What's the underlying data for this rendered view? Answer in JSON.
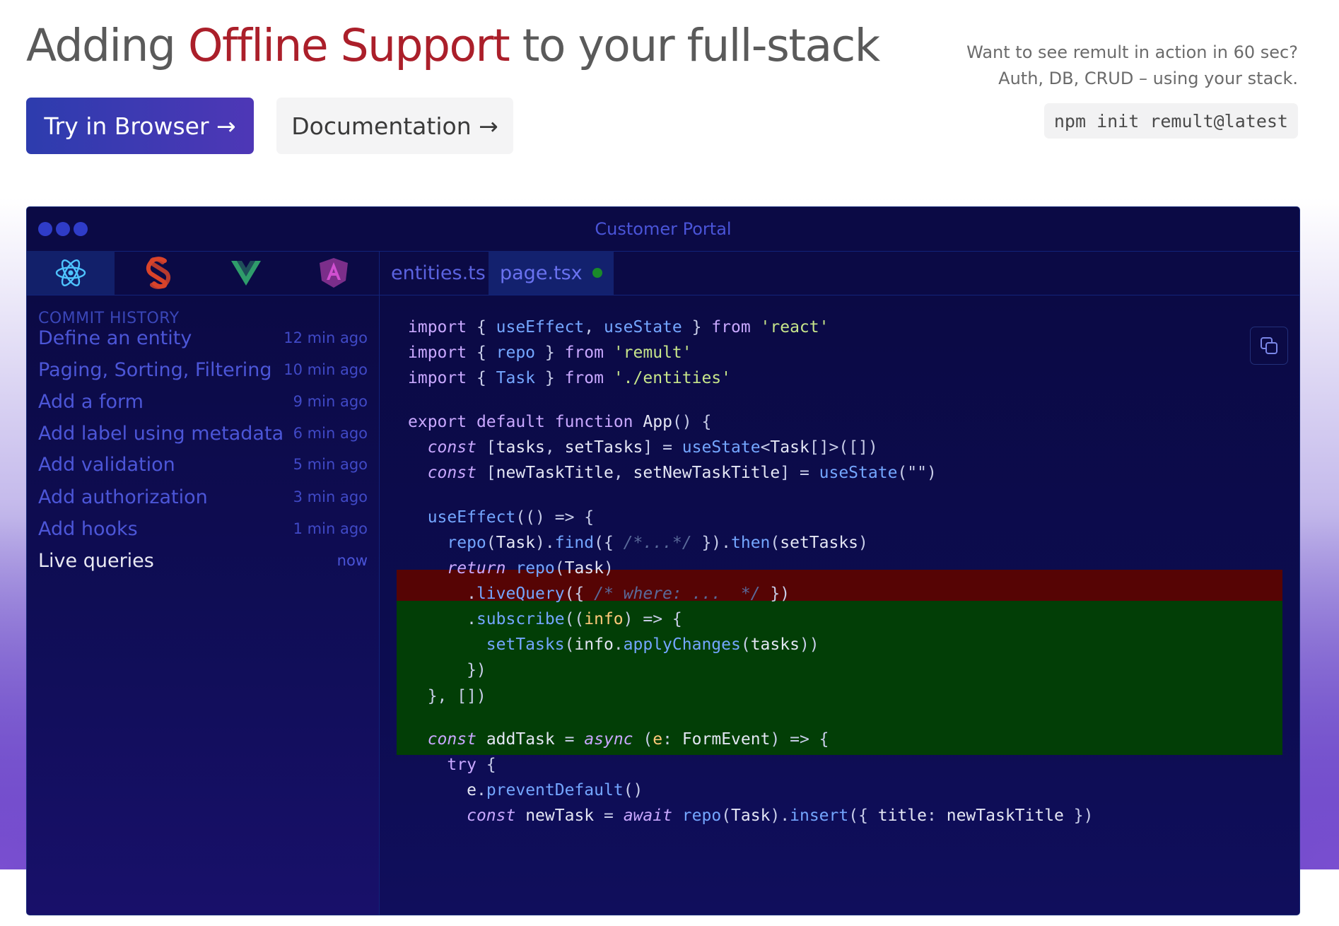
{
  "header": {
    "title_prefix": "Adding",
    "title_highlight": "Offline Support",
    "title_suffix": "to your full-stack",
    "try_button": "Try in Browser →",
    "docs_button": "Documentation →",
    "promo_line1": "Want to see remult in action in 60 sec?",
    "promo_line2": "Auth, DB, CRUD – using your stack.",
    "npm_command": "npm init remult@latest"
  },
  "window": {
    "title": "Customer Portal",
    "frameworks": [
      {
        "icon": "react-icon",
        "active": true
      },
      {
        "icon": "svelte-icon",
        "active": false
      },
      {
        "icon": "vue-icon",
        "active": false
      },
      {
        "icon": "angular-icon",
        "active": false
      }
    ],
    "file_tabs": [
      {
        "label": "entities.ts",
        "active": false
      },
      {
        "label": "page.tsx",
        "active": true,
        "modified": true
      }
    ]
  },
  "sidebar": {
    "heading": "COMMIT HISTORY",
    "commits": [
      {
        "label": "Define an entity",
        "time": "12 min ago"
      },
      {
        "label": "Paging, Sorting, Filtering",
        "time": "10 min ago"
      },
      {
        "label": "Add a form",
        "time": "9 min ago"
      },
      {
        "label": "Add label using metadata",
        "time": "6 min ago"
      },
      {
        "label": "Add validation",
        "time": "5 min ago"
      },
      {
        "label": "Add authorization",
        "time": "3 min ago"
      },
      {
        "label": "Add hooks",
        "time": "1 min ago"
      },
      {
        "label": "Live queries",
        "time": "now",
        "current": true
      }
    ]
  },
  "code": {
    "lines": [
      [
        [
          "kw",
          "import"
        ],
        [
          "pn",
          " { "
        ],
        [
          "fn",
          "useEffect"
        ],
        [
          "pn",
          ", "
        ],
        [
          "fn",
          "useState"
        ],
        [
          "pn",
          " } "
        ],
        [
          "kw",
          "from"
        ],
        [
          "pn",
          " "
        ],
        [
          "str",
          "'react'"
        ]
      ],
      [
        [
          "kw",
          "import"
        ],
        [
          "pn",
          " { "
        ],
        [
          "fn",
          "repo"
        ],
        [
          "pn",
          " } "
        ],
        [
          "kw",
          "from"
        ],
        [
          "pn",
          " "
        ],
        [
          "str",
          "'remult'"
        ]
      ],
      [
        [
          "kw",
          "import"
        ],
        [
          "pn",
          " { "
        ],
        [
          "fn",
          "Task"
        ],
        [
          "pn",
          " } "
        ],
        [
          "kw",
          "from"
        ],
        [
          "pn",
          " "
        ],
        [
          "str",
          "'./entities'"
        ]
      ],
      [
        [
          "kw",
          "export"
        ],
        [
          "pn",
          " "
        ],
        [
          "kw",
          "default"
        ],
        [
          "pn",
          " "
        ],
        [
          "kw",
          "function"
        ],
        [
          "pn",
          " "
        ],
        [
          "var",
          "App"
        ],
        [
          "pn",
          "() {"
        ]
      ],
      [
        [
          "pn",
          "  "
        ],
        [
          "ctl",
          "const"
        ],
        [
          "pn",
          " ["
        ],
        [
          "var",
          "tasks"
        ],
        [
          "pn",
          ", "
        ],
        [
          "var",
          "setTasks"
        ],
        [
          "pn",
          "] = "
        ],
        [
          "fn",
          "useState"
        ],
        [
          "pn",
          "<"
        ],
        [
          "var",
          "Task"
        ],
        [
          "pn",
          "[]>([])"
        ]
      ],
      [
        [
          "pn",
          "  "
        ],
        [
          "ctl",
          "const"
        ],
        [
          "pn",
          " ["
        ],
        [
          "var",
          "newTaskTitle"
        ],
        [
          "pn",
          ", "
        ],
        [
          "var",
          "setNewTaskTitle"
        ],
        [
          "pn",
          "] = "
        ],
        [
          "fn",
          "useState"
        ],
        [
          "pn",
          "(\"\")"
        ]
      ],
      [
        [
          "pn",
          "  "
        ],
        [
          "fn",
          "useEffect"
        ],
        [
          "pn",
          "(() => {"
        ]
      ],
      [
        [
          "pn",
          "    "
        ],
        [
          "fn",
          "repo"
        ],
        [
          "pn",
          "("
        ],
        [
          "var",
          "Task"
        ],
        [
          "pn",
          ")."
        ],
        [
          "fn",
          "find"
        ],
        [
          "pn",
          "({ "
        ],
        [
          "cmt",
          "/*...*/"
        ],
        [
          "pn",
          " })."
        ],
        [
          "fn",
          "then"
        ],
        [
          "pn",
          "("
        ],
        [
          "var",
          "setTasks"
        ],
        [
          "pn",
          ")"
        ]
      ],
      [
        [
          "pn",
          "    "
        ],
        [
          "ctl",
          "return"
        ],
        [
          "pn",
          " "
        ],
        [
          "fn",
          "repo"
        ],
        [
          "pn",
          "("
        ],
        [
          "var",
          "Task"
        ],
        [
          "pn",
          ")"
        ]
      ],
      [
        [
          "pn",
          "      ."
        ],
        [
          "fn",
          "liveQuery"
        ],
        [
          "pn",
          "({ "
        ],
        [
          "cmt",
          "/* where: ...  */"
        ],
        [
          "pn",
          " })"
        ]
      ],
      [
        [
          "pn",
          "      ."
        ],
        [
          "fn",
          "subscribe"
        ],
        [
          "pn",
          "(("
        ],
        [
          "par",
          "info"
        ],
        [
          "pn",
          ") => {"
        ]
      ],
      [
        [
          "pn",
          "        "
        ],
        [
          "fn",
          "setTasks"
        ],
        [
          "pn",
          "("
        ],
        [
          "var",
          "info"
        ],
        [
          "pn",
          "."
        ],
        [
          "fn",
          "applyChanges"
        ],
        [
          "pn",
          "("
        ],
        [
          "var",
          "tasks"
        ],
        [
          "pn",
          "))"
        ]
      ],
      [
        [
          "pn",
          "      })"
        ]
      ],
      [
        [
          "pn",
          "  }, [])"
        ]
      ],
      [
        [
          "pn",
          "  "
        ],
        [
          "ctl",
          "const"
        ],
        [
          "pn",
          " "
        ],
        [
          "var",
          "addTask"
        ],
        [
          "pn",
          " = "
        ],
        [
          "ctl",
          "async"
        ],
        [
          "pn",
          " ("
        ],
        [
          "par",
          "e"
        ],
        [
          "pn",
          ": "
        ],
        [
          "var",
          "FormEvent"
        ],
        [
          "pn",
          ") => {"
        ]
      ],
      [
        [
          "pn",
          "    "
        ],
        [
          "kw",
          "try"
        ],
        [
          "pn",
          " {"
        ]
      ],
      [
        [
          "pn",
          "      "
        ],
        [
          "var",
          "e"
        ],
        [
          "pn",
          "."
        ],
        [
          "fn",
          "preventDefault"
        ],
        [
          "pn",
          "()"
        ]
      ],
      [
        [
          "pn",
          "      "
        ],
        [
          "ctl",
          "const"
        ],
        [
          "pn",
          " "
        ],
        [
          "var",
          "newTask"
        ],
        [
          "pn",
          " = "
        ],
        [
          "ctl",
          "await"
        ],
        [
          "pn",
          " "
        ],
        [
          "fn",
          "repo"
        ],
        [
          "pn",
          "("
        ],
        [
          "var",
          "Task"
        ],
        [
          "pn",
          ")."
        ],
        [
          "fn",
          "insert"
        ],
        [
          "pn",
          "({ "
        ],
        [
          "var",
          "title"
        ],
        [
          "pn",
          ": "
        ],
        [
          "var",
          "newTaskTitle"
        ],
        [
          "pn",
          " })"
        ]
      ]
    ]
  },
  "colors": {
    "accent": "#ab1f2a",
    "window_bg": "#0b0a45",
    "deleted_line": "#560404",
    "added_line": "#023e06"
  }
}
